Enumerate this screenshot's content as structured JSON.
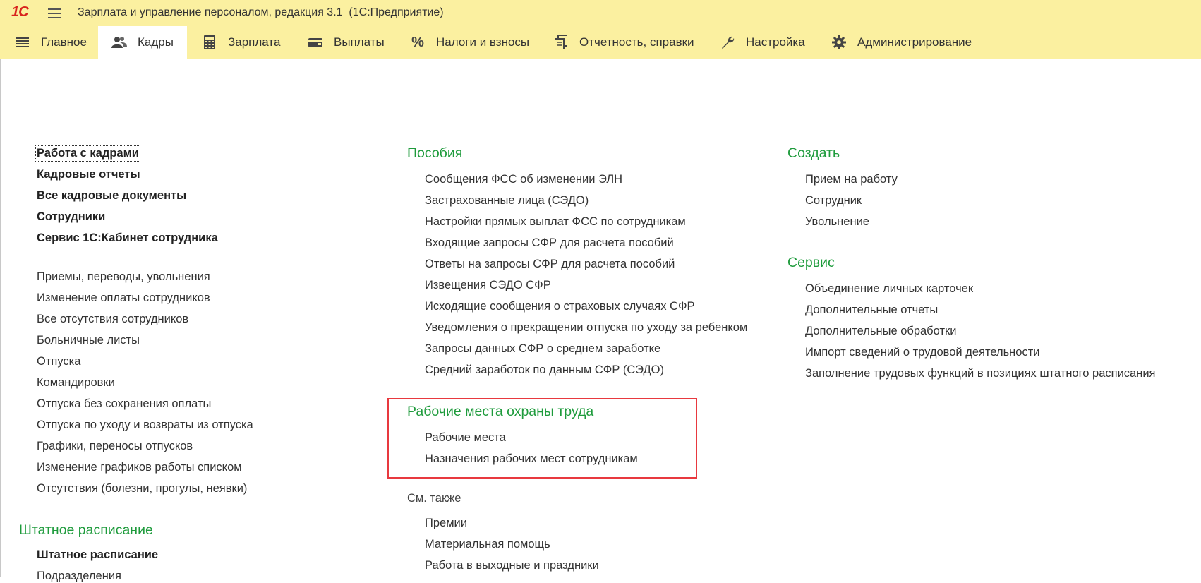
{
  "app": {
    "logo": "1С",
    "title": "Зарплата и управление персоналом, редакция 3.1  (1С:Предприятие)"
  },
  "menu": {
    "tabs": [
      {
        "label": "Главное",
        "icon": "list-icon"
      },
      {
        "label": "Кадры",
        "icon": "people-icon",
        "active": true
      },
      {
        "label": "Зарплата",
        "icon": "calculator-icon"
      },
      {
        "label": "Выплаты",
        "icon": "wallet-icon"
      },
      {
        "label": "Налоги и взносы",
        "icon": "percent-icon"
      },
      {
        "label": "Отчетность, справки",
        "icon": "documents-icon"
      },
      {
        "label": "Настройка",
        "icon": "wrench-icon"
      },
      {
        "label": "Администрирование",
        "icon": "gear-icon"
      }
    ]
  },
  "left": {
    "main_links": [
      "Работа с кадрами",
      "Кадровые отчеты",
      "Все кадровые документы",
      "Сотрудники",
      "Сервис 1С:Кабинет сотрудника"
    ],
    "doc_links": [
      "Приемы, переводы, увольнения",
      "Изменение оплаты сотрудников",
      "Все отсутствия сотрудников",
      "Больничные листы",
      "Отпуска",
      "Командировки",
      "Отпуска без сохранения оплаты",
      "Отпуска по уходу и возвраты из отпуска",
      "Графики, переносы отпусков",
      "Изменение графиков работы списком",
      "Отсутствия (болезни, прогулы, неявки)"
    ],
    "staff_section": {
      "title": "Штатное расписание",
      "links": [
        "Штатное расписание",
        "Подразделения"
      ]
    }
  },
  "middle": {
    "benefits": {
      "title": "Пособия",
      "links": [
        "Сообщения ФСС об изменении ЭЛН",
        "Застрахованные лица (СЭДО)",
        "Настройки прямых выплат ФСС по сотрудникам",
        "Входящие запросы СФР для расчета пособий",
        "Ответы на запросы СФР для расчета пособий",
        "Извещения СЭДО СФР",
        "Исходящие сообщения о страховых случаях СФР",
        "Уведомления о прекращении отпуска по уходу за ребенком",
        "Запросы данных СФР о среднем заработке",
        "Средний заработок по данным СФР (СЭДО)"
      ]
    },
    "workplaces": {
      "title": "Рабочие места охраны труда",
      "links": [
        "Рабочие места",
        "Назначения рабочих мест сотрудникам"
      ]
    },
    "see_also": {
      "title": "См. также",
      "links": [
        "Премии",
        "Материальная помощь",
        "Работа в выходные и праздники"
      ]
    }
  },
  "right": {
    "create": {
      "title": "Создать",
      "links": [
        "Прием на работу",
        "Сотрудник",
        "Увольнение"
      ]
    },
    "service": {
      "title": "Сервис",
      "links": [
        "Объединение личных карточек",
        "Дополнительные отчеты",
        "Дополнительные обработки",
        "Импорт сведений о трудовой деятельности",
        "Заполнение трудовых функций в позициях штатного расписания"
      ]
    }
  },
  "colors": {
    "topbar": "#fbf0a0",
    "section_green": "#1e9b3c",
    "highlight_red": "#e8393f",
    "logo_red": "#d8231d"
  }
}
